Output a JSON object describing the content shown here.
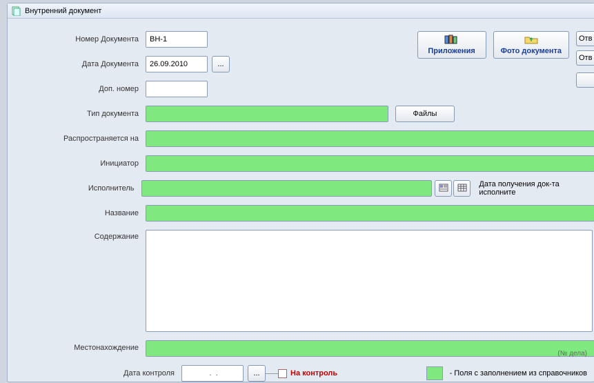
{
  "window": {
    "title": "Внутренний документ"
  },
  "topButtons": {
    "attachments": "Приложения",
    "photo": "Фото документа",
    "edge1": "Отв",
    "edge2": "Отв"
  },
  "fields": {
    "docNumberLabel": "Номер Документа",
    "docNumberValue": "ВН-1",
    "docDateLabel": "Дата Документа",
    "docDateValue": "26.09.2010",
    "addNumberLabel": "Доп. номер",
    "addNumberValue": "",
    "docTypeLabel": "Тип документа",
    "filesBtn": "Файлы",
    "spreadLabel": "Распространяется на",
    "initiatorLabel": "Инициатор",
    "executorLabel": "Исполнитель",
    "executorDateLabel": "Дата получения док-та исполните",
    "titleLabel": "Название",
    "contentLabel": "Содержание",
    "locationLabel": "Местонахождение",
    "locationSub": "(№ дела)",
    "controlDateLabel": "Дата контроля",
    "controlDateValue": " .  .",
    "onControlLabel": "На контроль",
    "legendText": "- Поля с заполнением из справочников"
  }
}
